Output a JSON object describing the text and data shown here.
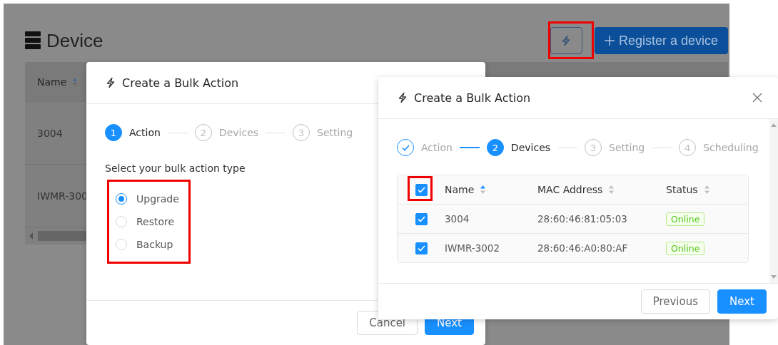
{
  "page": {
    "title": "Device",
    "register_button": "Register a device"
  },
  "table": {
    "columns": [
      {
        "label": "Name",
        "sorted": true
      }
    ],
    "rows": [
      "3004",
      "IWMR-300"
    ]
  },
  "dialog_action": {
    "title": "Create a Bulk Action",
    "steps": [
      {
        "number": "1",
        "label": "Action",
        "current": true,
        "done": false
      },
      {
        "number": "2",
        "label": "Devices",
        "current": false,
        "done": false
      },
      {
        "number": "3",
        "label": "Setting",
        "current": false,
        "done": false
      }
    ],
    "prompt": "Select your bulk action type",
    "options": [
      {
        "label": "Upgrade",
        "selected": true
      },
      {
        "label": "Restore",
        "selected": false
      },
      {
        "label": "Backup",
        "selected": false
      }
    ],
    "buttons": [
      {
        "label": "Cancel",
        "kind": "default"
      },
      {
        "label": "Next",
        "kind": "primary"
      }
    ]
  },
  "dialog_devices": {
    "title": "Create a Bulk Action",
    "steps": [
      {
        "label": "Action",
        "current": false,
        "done": true
      },
      {
        "number": "2",
        "label": "Devices",
        "current": true,
        "done": false
      },
      {
        "number": "3",
        "label": "Setting",
        "current": false,
        "done": false
      },
      {
        "number": "4",
        "label": "Scheduling",
        "current": false,
        "done": false
      }
    ],
    "select_all": {
      "checked": true
    },
    "columns": [
      {
        "label": "Name",
        "sorted": true
      },
      {
        "label": "MAC Address",
        "sorted": false
      },
      {
        "label": "Status",
        "sorted": false
      }
    ],
    "rows": [
      {
        "name": "3004",
        "mac": "28:60:46:81:05:03",
        "status": "Online",
        "checked": true
      },
      {
        "name": "IWMR-3002",
        "mac": "28:60:46:A0:80:AF",
        "status": "Online",
        "checked": true
      }
    ],
    "buttons": [
      {
        "label": "Previous",
        "kind": "default"
      },
      {
        "label": "Next",
        "kind": "primary"
      }
    ]
  }
}
